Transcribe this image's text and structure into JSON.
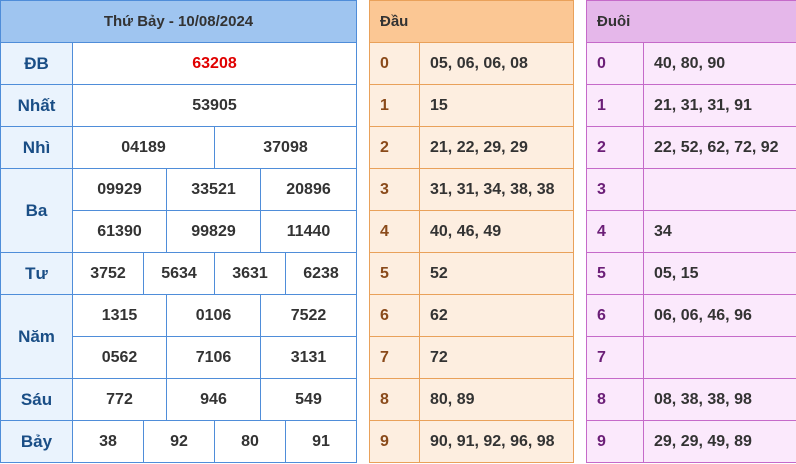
{
  "results": {
    "title": "Thứ Bảy - 10/08/2024",
    "rows": [
      {
        "label": "ĐB",
        "values": [
          "63208"
        ]
      },
      {
        "label": "Nhất",
        "values": [
          "53905"
        ]
      },
      {
        "label": "Nhì",
        "values": [
          "04189",
          "37098"
        ]
      },
      {
        "label": "Ba",
        "values": [
          "09929",
          "33521",
          "20896",
          "61390",
          "99829",
          "11440"
        ]
      },
      {
        "label": "Tư",
        "values": [
          "3752",
          "5634",
          "3631",
          "6238"
        ]
      },
      {
        "label": "Năm",
        "values": [
          "1315",
          "0106",
          "7522",
          "0562",
          "7106",
          "3131"
        ]
      },
      {
        "label": "Sáu",
        "values": [
          "772",
          "946",
          "549"
        ]
      },
      {
        "label": "Bảy",
        "values": [
          "38",
          "92",
          "80",
          "91"
        ]
      }
    ]
  },
  "dau": {
    "header": "Đầu",
    "rows": [
      {
        "digit": "0",
        "values": "05, 06, 06, 08"
      },
      {
        "digit": "1",
        "values": "15"
      },
      {
        "digit": "2",
        "values": "21, 22, 29, 29"
      },
      {
        "digit": "3",
        "values": "31, 31, 34, 38, 38"
      },
      {
        "digit": "4",
        "values": "40, 46, 49"
      },
      {
        "digit": "5",
        "values": "52"
      },
      {
        "digit": "6",
        "values": "62"
      },
      {
        "digit": "7",
        "values": "72"
      },
      {
        "digit": "8",
        "values": "80, 89"
      },
      {
        "digit": "9",
        "values": "90, 91, 92, 96, 98"
      }
    ]
  },
  "duoi": {
    "header": "Đuôi",
    "rows": [
      {
        "digit": "0",
        "values": "40, 80, 90"
      },
      {
        "digit": "1",
        "values": "21, 31, 31, 91"
      },
      {
        "digit": "2",
        "values": "22, 52, 62, 72, 92"
      },
      {
        "digit": "3",
        "values": ""
      },
      {
        "digit": "4",
        "values": "34"
      },
      {
        "digit": "5",
        "values": "05, 15"
      },
      {
        "digit": "6",
        "values": "06, 06, 46, 96"
      },
      {
        "digit": "7",
        "values": ""
      },
      {
        "digit": "8",
        "values": "08, 38, 38, 98"
      },
      {
        "digit": "9",
        "values": "29, 29, 49, 89"
      }
    ]
  },
  "colors": {
    "results_header": "#9fc5f0",
    "results_border": "#4f8dd9",
    "db_value": "#e00000",
    "dau_header": "#fbc794",
    "dau_cell": "#fdeee0",
    "duoi_header": "#e5b7ea",
    "duoi_cell": "#fbe9fc"
  }
}
